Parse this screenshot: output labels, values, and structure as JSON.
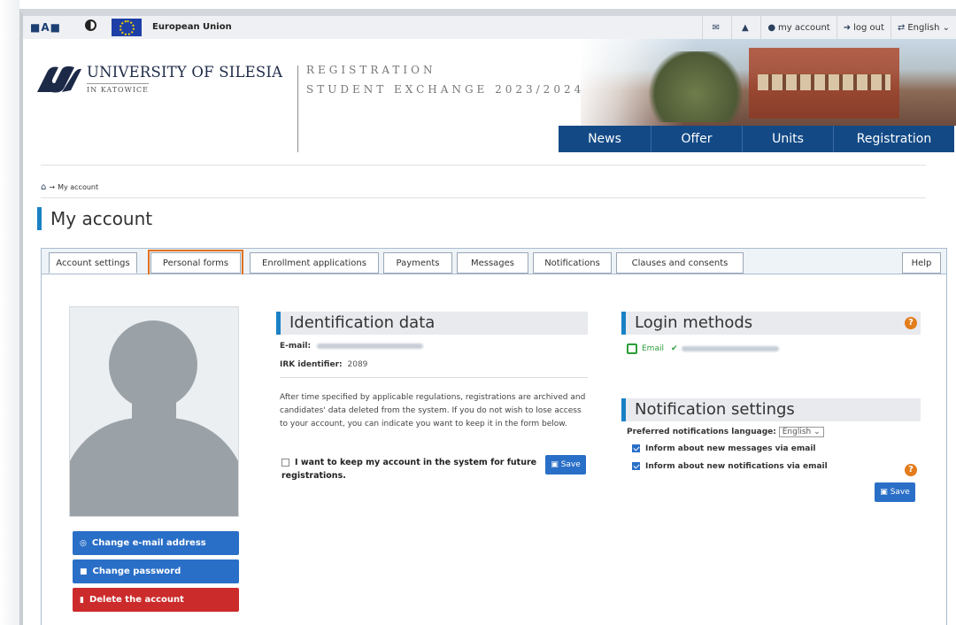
{
  "topbar": {
    "a11y_label": "■A■",
    "eu_label": "European Union",
    "items": [
      {
        "icon": "✉",
        "label": ""
      },
      {
        "icon": "🔔",
        "label": ""
      },
      {
        "icon": "👤",
        "label": "my account"
      },
      {
        "icon": "➜",
        "label": "log out"
      },
      {
        "icon": "文",
        "label": "English ⌄"
      }
    ]
  },
  "header": {
    "university": "UNIVERSITY OF SILESIA",
    "university_sub": "IN KATOWICE",
    "registration": "REGISTRATION",
    "program": "STUDENT EXCHANGE 2023/2024",
    "nav": [
      "News",
      "Offer",
      "Units",
      "Registration"
    ]
  },
  "breadcrumb": {
    "home_icon": "home-icon",
    "separator": "→",
    "current": "My account"
  },
  "page_title": "My account",
  "tabs": [
    {
      "label": "Account settings",
      "active": true
    },
    {
      "label": "Personal forms",
      "active": false,
      "highlight": true
    },
    {
      "label": "Enrollment applications",
      "active": false
    },
    {
      "label": "Payments",
      "active": false
    },
    {
      "label": "Messages",
      "active": false
    },
    {
      "label": "Notifications",
      "active": false
    },
    {
      "label": "Clauses and consents",
      "active": false
    }
  ],
  "help_tab": "Help",
  "side_buttons": {
    "change_email": "Change e-mail address",
    "change_password": "Change password",
    "delete_account": "Delete the account"
  },
  "identification": {
    "title": "Identification data",
    "email_label": "E-mail:",
    "irk_label": "IRK identifier:",
    "irk_value": "2089",
    "paragraph": "After time specified by applicable regulations, registrations are archived and candidates' data deleted from the system. If you do not wish to lose access to your account, you can indicate you want to keep it in the form below.",
    "keep_label": "I want to keep my account in the system for future registrations.",
    "save": "Save"
  },
  "login_methods": {
    "title": "Login methods",
    "method": "Email"
  },
  "notification_settings": {
    "title": "Notification settings",
    "language_label": "Preferred notifications language:",
    "language_value": "English ⌄",
    "opt_messages": "Inform about new messages via email",
    "opt_notifications": "Inform about new notifications via email",
    "save": "Save"
  },
  "colors": {
    "brand_blue": "#134a86",
    "accent": "#1a81c5",
    "button_blue": "#2a6fc7",
    "danger": "#cc2b2b",
    "highlight": "#e0701e"
  }
}
